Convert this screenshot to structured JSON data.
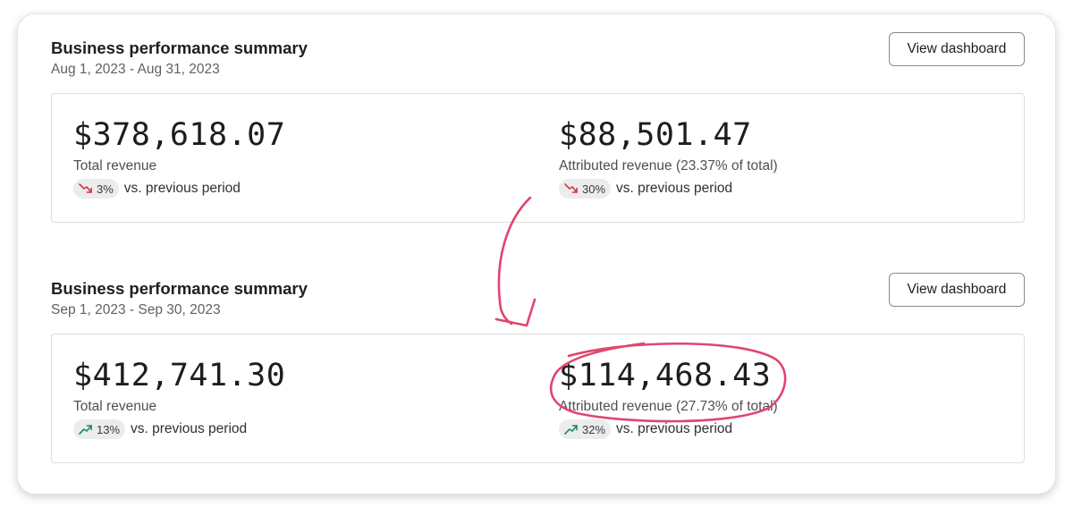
{
  "colors": {
    "annotation": "#e0466e",
    "trend_down": "#d1353b",
    "trend_up": "#1c8a5a",
    "badge_bg": "#ececec"
  },
  "summaries": [
    {
      "title": "Business performance summary",
      "date_range": "Aug 1, 2023 - Aug 31, 2023",
      "button_label": "View dashboard",
      "metrics": [
        {
          "value": "$378,618.07",
          "label": "Total revenue",
          "change": "3%",
          "trend": "down",
          "trend_icon": "trending-down-icon",
          "comparison": "vs. previous period"
        },
        {
          "value": "$88,501.47",
          "label": "Attributed revenue (23.37% of total)",
          "change": "30%",
          "trend": "down",
          "trend_icon": "trending-down-icon",
          "comparison": "vs. previous period"
        }
      ]
    },
    {
      "title": "Business performance summary",
      "date_range": "Sep 1, 2023 - Sep 30, 2023",
      "button_label": "View dashboard",
      "metrics": [
        {
          "value": "$412,741.30",
          "label": "Total revenue",
          "change": "13%",
          "trend": "up",
          "trend_icon": "trending-up-icon",
          "comparison": "vs. previous period"
        },
        {
          "value": "$114,468.43",
          "label": "Attributed revenue (27.73% of total)",
          "change": "32%",
          "trend": "up",
          "trend_icon": "trending-up-icon",
          "comparison": "vs. previous period"
        }
      ]
    }
  ]
}
